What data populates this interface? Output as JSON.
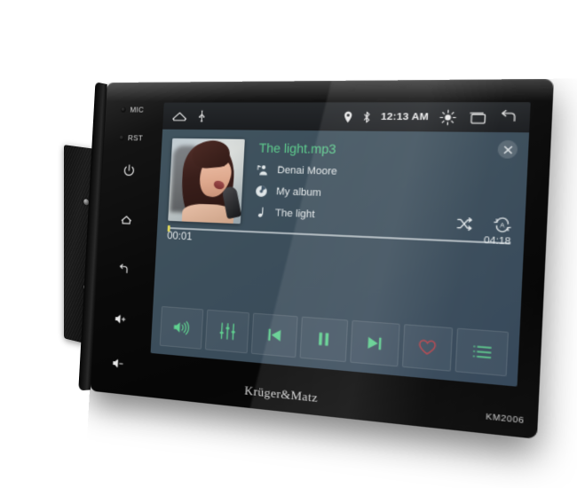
{
  "device": {
    "brand": "Krüger&Matz",
    "model": "KM2006"
  },
  "side_controls": [
    {
      "name": "mic",
      "label": "MIC",
      "icon": "mic-dot"
    },
    {
      "name": "reset",
      "label": "RST",
      "icon": "reset-dot"
    },
    {
      "name": "power",
      "label": "",
      "icon": "power-icon"
    },
    {
      "name": "home",
      "label": "",
      "icon": "home-icon"
    },
    {
      "name": "back",
      "label": "",
      "icon": "back-icon"
    },
    {
      "name": "volume-up",
      "label": "",
      "icon": "volume-up-icon"
    },
    {
      "name": "volume-down",
      "label": "",
      "icon": "volume-down-icon"
    }
  ],
  "statusbar": {
    "left_icons": [
      {
        "name": "home-icon"
      },
      {
        "name": "usb-icon"
      }
    ],
    "right_icons_before_time": [
      {
        "name": "location-pin-icon"
      },
      {
        "name": "bluetooth-icon"
      }
    ],
    "time": "12:13 AM",
    "right_icons_after_time": [
      {
        "name": "brightness-icon"
      },
      {
        "name": "recents-icon"
      },
      {
        "name": "back-icon"
      }
    ]
  },
  "player": {
    "track_title": "The light.mp3",
    "title_color": "#5fcf8f",
    "close_label": "✕",
    "meta": [
      {
        "icon": "artist-icon",
        "value": "Denai Moore"
      },
      {
        "icon": "album-disc-icon",
        "value": "My album"
      },
      {
        "icon": "music-note-icon",
        "value": "The light"
      }
    ],
    "mode_icons": [
      {
        "name": "shuffle-icon"
      },
      {
        "name": "repeat-all-icon"
      }
    ],
    "progress": {
      "current_time": "00:01",
      "total_time": "04:18",
      "percent": 0
    },
    "controls": [
      {
        "name": "volume-button",
        "icon": "speaker-icon",
        "color": "#5fcf8f"
      },
      {
        "name": "equalizer-button",
        "icon": "equalizer-icon",
        "color": "#5fcf8f"
      },
      {
        "name": "previous-button",
        "icon": "previous-track-icon",
        "color": "#5fcf8f"
      },
      {
        "name": "pause-button",
        "icon": "pause-icon",
        "color": "#5fcf8f"
      },
      {
        "name": "next-button",
        "icon": "next-track-icon",
        "color": "#5fcf8f"
      },
      {
        "name": "favorite-button",
        "icon": "heart-icon",
        "color": "#b5474f"
      },
      {
        "name": "playlist-button",
        "icon": "playlist-icon",
        "color": "#5fcf8f"
      }
    ]
  },
  "theme": {
    "screen_bg": "#3f5160",
    "accent_green": "#5fcf8f",
    "bezel_black": "#0a0a0a",
    "page_bg": "#ffffff"
  }
}
